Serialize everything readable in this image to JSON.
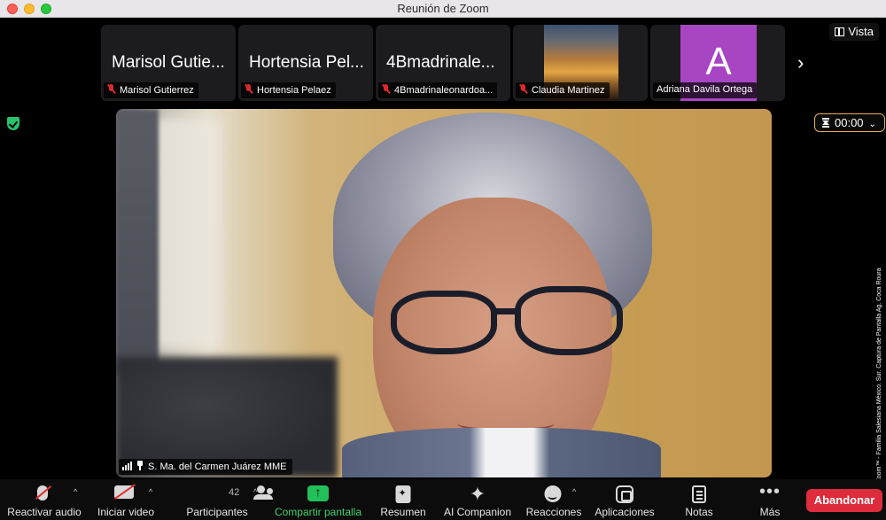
{
  "window": {
    "title": "Reunión de Zoom"
  },
  "view_button": {
    "label": "Vista"
  },
  "participants_strip": [
    {
      "display_name": "Marisol Gutie...",
      "label": "Marisol Gutierrez",
      "muted": true,
      "tile": "name"
    },
    {
      "display_name": "Hortensia Pel...",
      "label": "Hortensia Pelaez",
      "muted": true,
      "tile": "name"
    },
    {
      "display_name": "4Bmadrinale...",
      "label": "4Bmadrinaleonardoa...",
      "muted": true,
      "tile": "name"
    },
    {
      "display_name": "",
      "label": "Claudia Martinez",
      "muted": true,
      "tile": "image"
    },
    {
      "display_name": "A",
      "label": "Adriana Davila Ortega",
      "muted": false,
      "tile": "avatar"
    }
  ],
  "timer": {
    "value": "00:00"
  },
  "speaker": {
    "label": "S. Ma. del Carmen Juárez MME"
  },
  "credit": {
    "text": "Cortesía © Zoom™ - Familia Salesiana México. Sur. Captura de Pantalla Ag. Coca Roura"
  },
  "toolbar": {
    "audio": "Reactivar audio",
    "video": "Iniciar video",
    "participants": "Participantes",
    "participant_count": "42",
    "share": "Compartir pantalla",
    "summary": "Resumen",
    "companion": "AI Companion",
    "reactions": "Reacciones",
    "apps": "Aplicaciones",
    "notes": "Notas",
    "more": "Más",
    "leave": "Abandonar"
  },
  "colors": {
    "leave": "#de2c3c",
    "share": "#22c05a",
    "avatar": "#a845c2",
    "timer_border": "#e0b04c"
  }
}
